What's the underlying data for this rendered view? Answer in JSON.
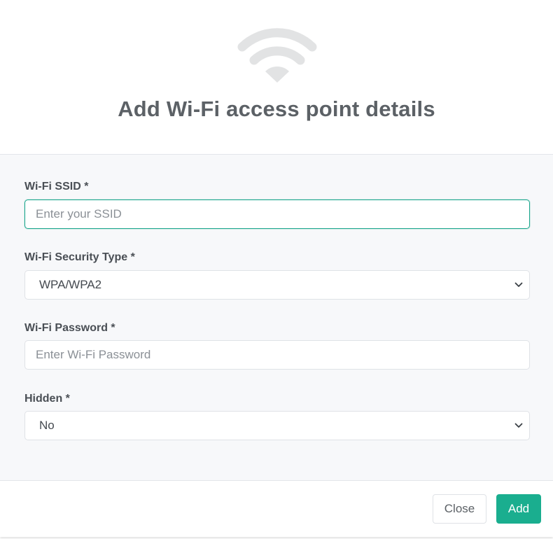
{
  "header": {
    "icon": "wifi-icon",
    "title": "Add Wi-Fi access point details"
  },
  "form": {
    "ssid": {
      "label": "Wi-Fi SSID *",
      "value": "",
      "placeholder": "Enter your SSID"
    },
    "security_type": {
      "label": "Wi-Fi Security Type *",
      "value": "WPA/WPA2"
    },
    "password": {
      "label": "Wi-Fi Password *",
      "value": "",
      "placeholder": "Enter Wi-Fi Password"
    },
    "hidden": {
      "label": "Hidden *",
      "value": "No"
    }
  },
  "footer": {
    "close_label": "Close",
    "add_label": "Add"
  },
  "colors": {
    "accent": "#1aae8f",
    "title": "#5c6166",
    "icon": "#e2e3e4",
    "body_background": "#f7f8fa"
  }
}
